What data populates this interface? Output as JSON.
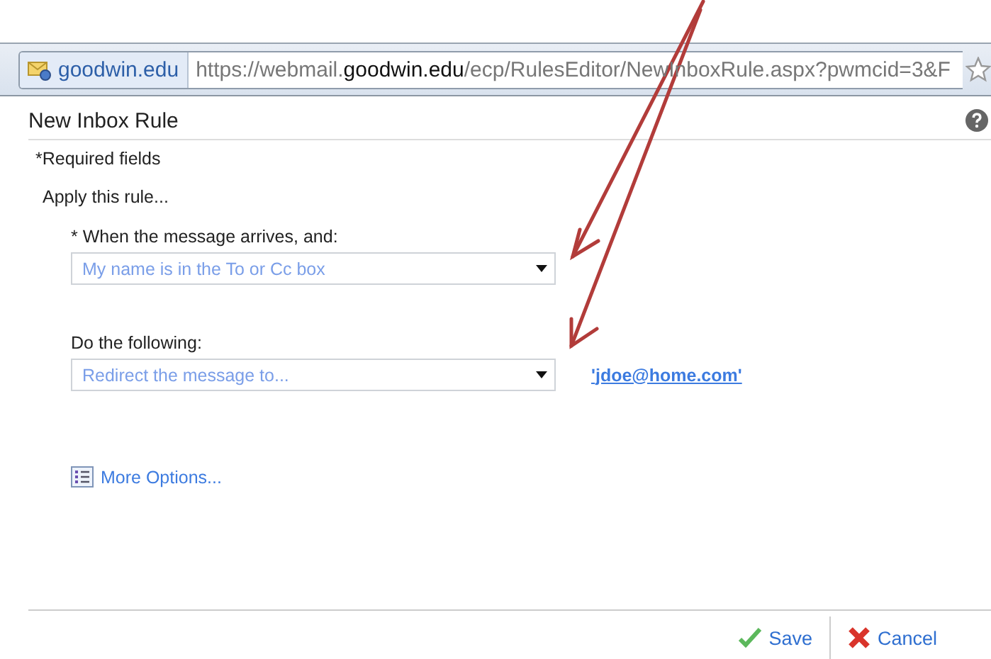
{
  "browser": {
    "site_badge": "goodwin.edu",
    "url": [
      {
        "text": "https://webmail.",
        "emphasis": false
      },
      {
        "text": "goodwin.edu",
        "emphasis": true
      },
      {
        "text": "/ecp/RulesEditor/NewInboxRule.aspx?pwmcid=3&F",
        "emphasis": false
      }
    ]
  },
  "dialog": {
    "title": "New Inbox Rule",
    "required_note": "*Required fields",
    "section": "Apply this rule...",
    "fields": [
      {
        "label": "* When the message arrives, and:",
        "value": "My name is in the To or Cc box"
      },
      {
        "label": "Do the following:",
        "value": "Redirect the message to...",
        "link": "'jdoe@home.com'"
      }
    ],
    "more_options": "More Options...",
    "buttons": [
      {
        "kind": "save",
        "label": "Save"
      },
      {
        "kind": "cancel",
        "label": "Cancel"
      }
    ]
  },
  "annotations": [
    {
      "kind": "arrow"
    },
    {
      "kind": "arrow"
    }
  ]
}
